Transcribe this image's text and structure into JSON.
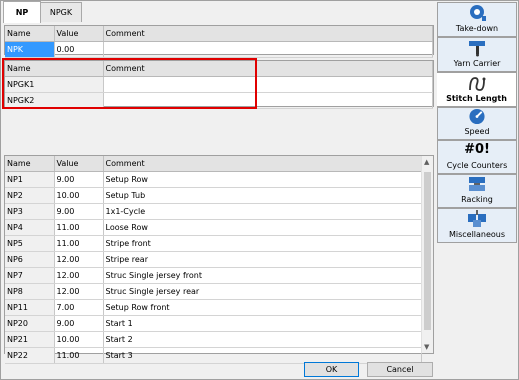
{
  "tabs": [
    {
      "label": "NP"
    },
    {
      "label": "NPGK"
    }
  ],
  "npk_table": {
    "headers": [
      "Name",
      "Value",
      "Comment"
    ],
    "row": {
      "name": "NPK",
      "value": "0.00",
      "comment": ""
    }
  },
  "npgk_table": {
    "headers": [
      "Name",
      "Comment"
    ],
    "rows": [
      {
        "name": "NPGK1",
        "comment": ""
      },
      {
        "name": "NPGK2",
        "comment": ""
      }
    ]
  },
  "np_table": {
    "headers": [
      "Name",
      "Value",
      "Comment"
    ],
    "rows": [
      {
        "name": "NP1",
        "value": "9.00",
        "comment": "Setup Row"
      },
      {
        "name": "NP2",
        "value": "10.00",
        "comment": "Setup Tub"
      },
      {
        "name": "NP3",
        "value": "9.00",
        "comment": "1x1-Cycle"
      },
      {
        "name": "NP4",
        "value": "11.00",
        "comment": "Loose Row"
      },
      {
        "name": "NP5",
        "value": "11.00",
        "comment": "Stripe front"
      },
      {
        "name": "NP6",
        "value": "12.00",
        "comment": "Stripe rear"
      },
      {
        "name": "NP7",
        "value": "12.00",
        "comment": "Struc Single jersey front"
      },
      {
        "name": "NP8",
        "value": "12.00",
        "comment": "Struc Single jersey rear"
      },
      {
        "name": "NP11",
        "value": "7.00",
        "comment": "Setup Row front"
      },
      {
        "name": "NP20",
        "value": "9.00",
        "comment": "Start 1"
      },
      {
        "name": "NP21",
        "value": "10.00",
        "comment": "Start 2"
      },
      {
        "name": "NP22",
        "value": "11.00",
        "comment": "Start 3"
      }
    ]
  },
  "sidebar": {
    "items": [
      {
        "label": "Take-down",
        "icon": "take-down-icon"
      },
      {
        "label": "Yarn Carrier",
        "icon": "yarn-carrier-icon"
      },
      {
        "label": "Stitch Length",
        "icon": "stitch-length-icon"
      },
      {
        "label": "Speed",
        "icon": "speed-icon"
      },
      {
        "label": "Cycle Counters",
        "icon": "cycle-counters-icon",
        "glyph": "#0!"
      },
      {
        "label": "Racking",
        "icon": "racking-icon"
      },
      {
        "label": "Miscellaneous",
        "icon": "miscellaneous-icon"
      }
    ]
  },
  "buttons": {
    "ok": "OK",
    "cancel": "Cancel"
  },
  "colors": {
    "selection": "#3399ff",
    "highlight_box": "#e00000",
    "icon_blue": "#2a6ebf"
  }
}
